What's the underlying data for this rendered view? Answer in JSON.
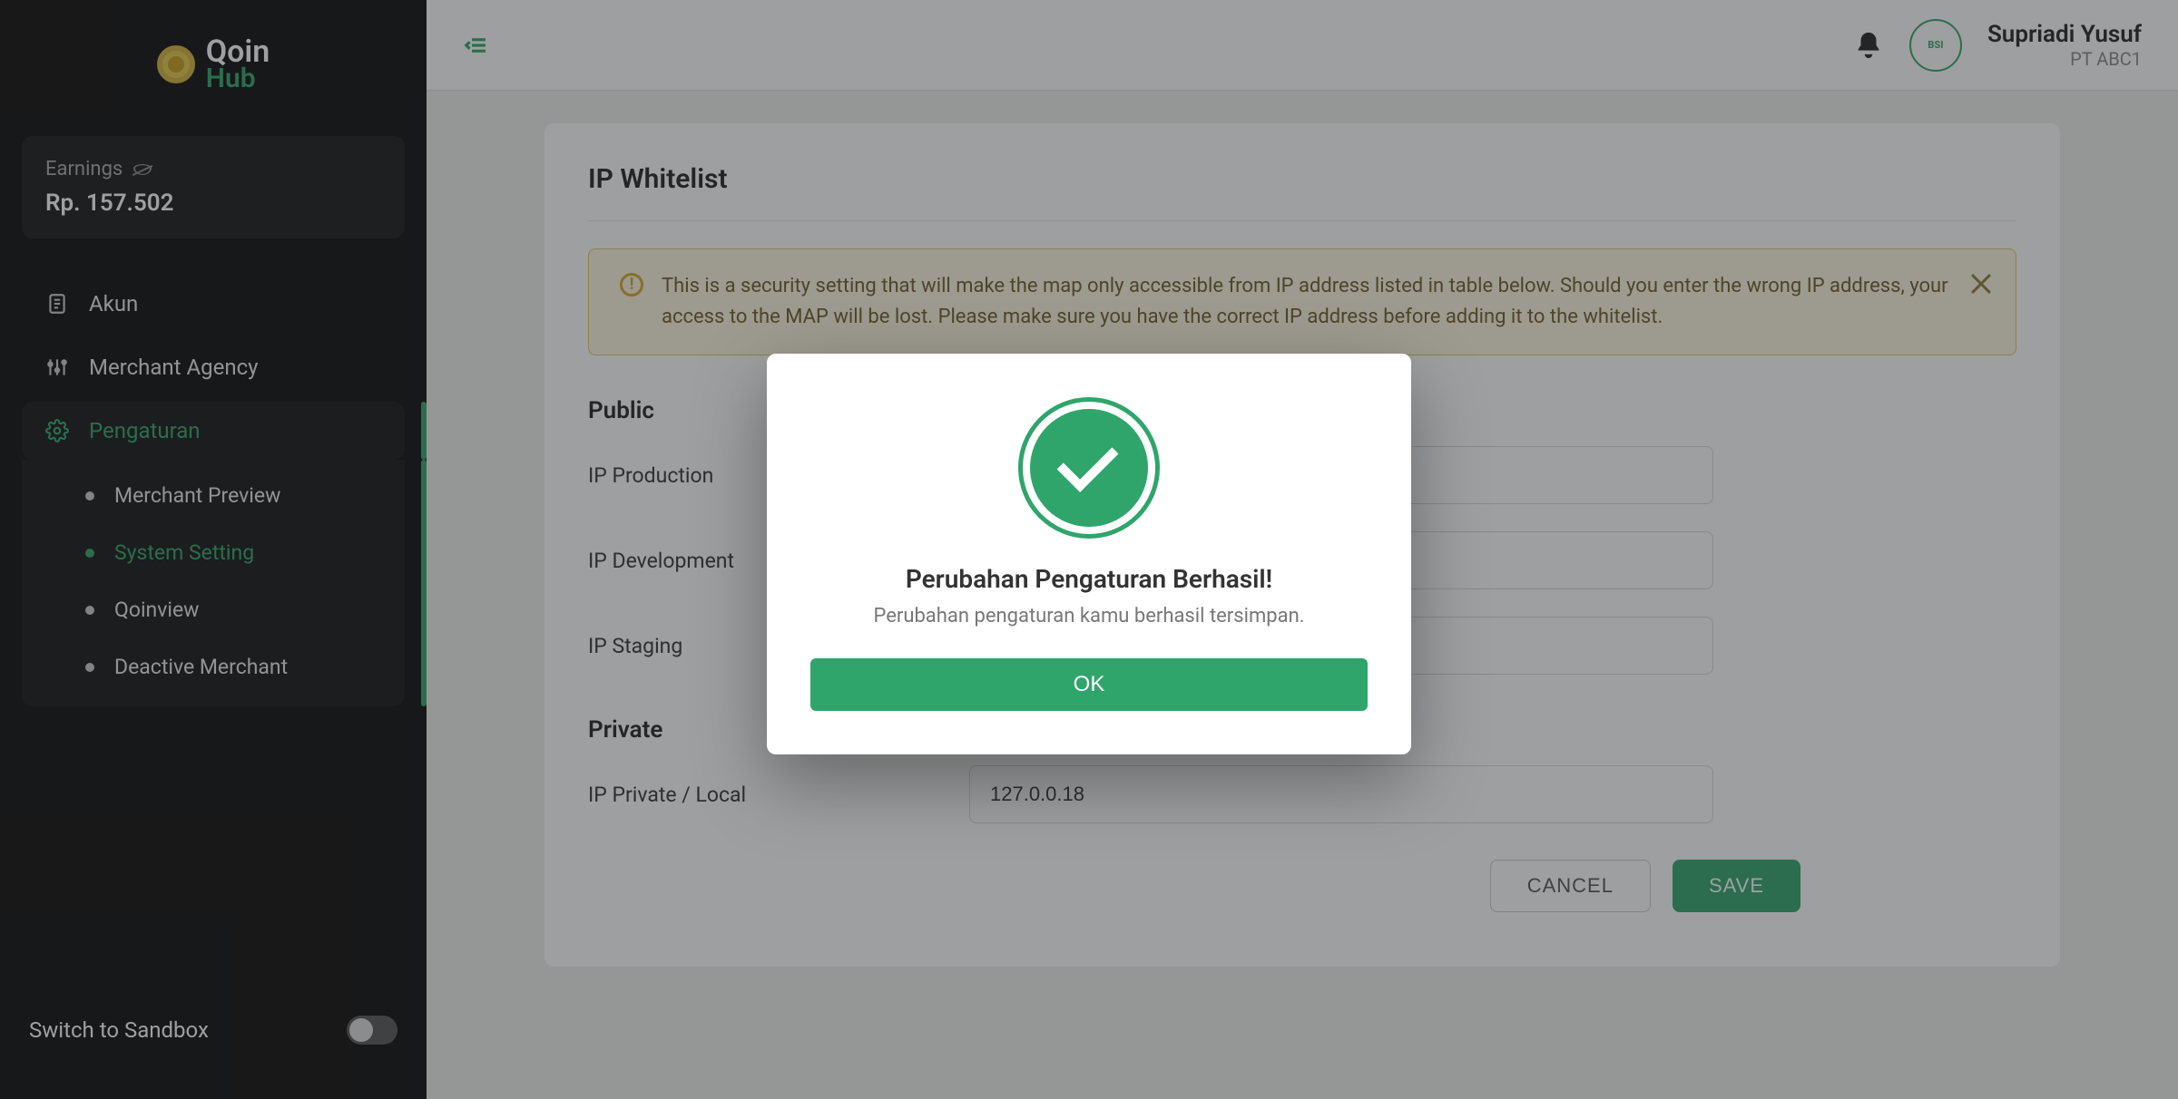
{
  "brand": {
    "name1": "Qoin",
    "name2": "Hub"
  },
  "earnings": {
    "label": "Earnings",
    "amount": "Rp. 157.502"
  },
  "nav": {
    "akun": "Akun",
    "merchant_agency": "Merchant Agency",
    "pengaturan": "Pengaturan",
    "sub": {
      "merchant_preview": "Merchant Preview",
      "system_setting": "System Setting",
      "qoinview": "Qoinview",
      "deactive_merchant": "Deactive Merchant"
    }
  },
  "switch_label": "Switch to Sandbox",
  "user": {
    "name": "Supriadi Yusuf",
    "org": "PT ABC1",
    "avatar_text": "BSI"
  },
  "page": {
    "title": "IP Whitelist",
    "alert": "This is a security setting that will make the map only accessible from IP address listed in table below. Should you enter the wrong IP address, your access to the MAP will be lost. Please make sure you have the correct IP address before adding it to the whitelist.",
    "public_title": "Public",
    "private_title": "Private",
    "fields": {
      "ip_production": {
        "label": "IP Production",
        "value": ""
      },
      "ip_development": {
        "label": "IP Development",
        "value": ""
      },
      "ip_staging": {
        "label": "IP Staging",
        "value": ""
      },
      "ip_private": {
        "label": "IP Private / Local",
        "value": "127.0.0.18"
      }
    },
    "cancel": "CANCEL",
    "save": "SAVE"
  },
  "modal": {
    "title": "Perubahan Pengaturan Berhasil!",
    "subtitle": "Perubahan pengaturan kamu berhasil tersimpan.",
    "ok": "OK"
  }
}
